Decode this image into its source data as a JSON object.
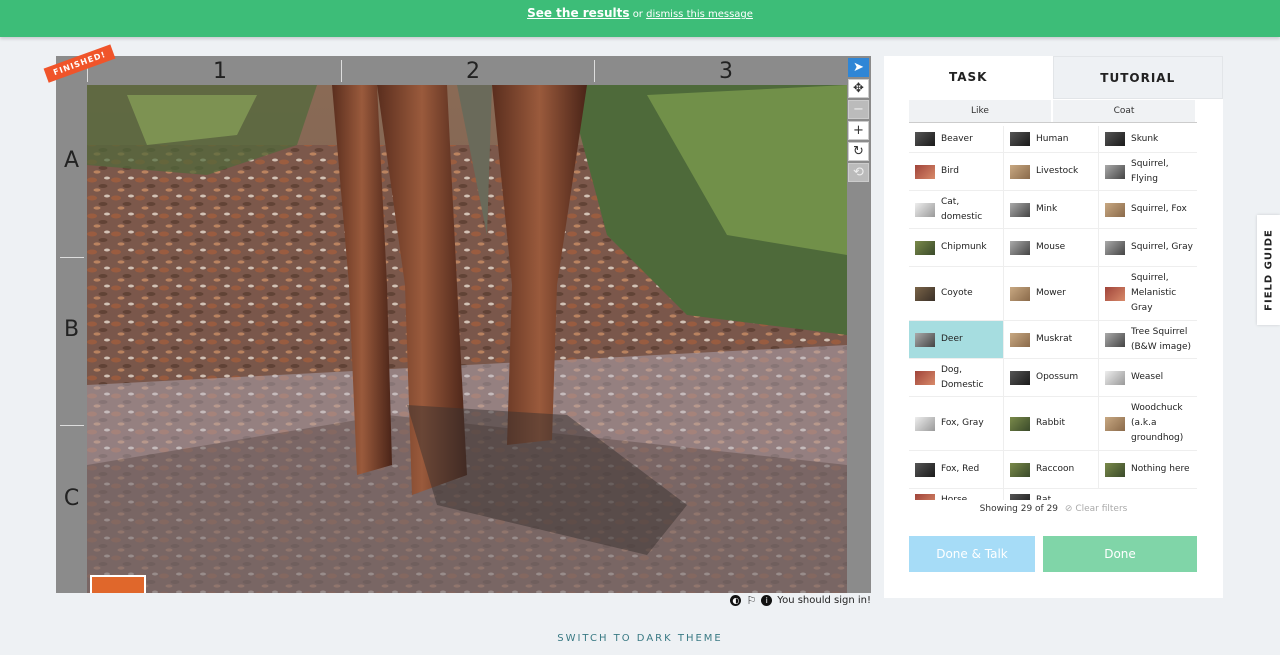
{
  "banner": {
    "see_results": "See the results",
    "or": "or",
    "dismiss": "dismiss this message"
  },
  "viewer": {
    "finished": "FINISHED!",
    "columns": [
      "1",
      "2",
      "3"
    ],
    "rows": [
      "A",
      "B",
      "C"
    ],
    "tools": [
      "pointer-icon",
      "move-icon",
      "zoom-out-icon",
      "zoom-in-icon",
      "rotate-icon",
      "reset-icon"
    ],
    "sign_in": "You should sign in!"
  },
  "task": {
    "tab_task": "TASK",
    "tab_tutorial": "TUTORIAL",
    "filter_like": "Like",
    "filter_coat": "Coat",
    "choices": [
      [
        {
          "label": "Beaver",
          "t": "dark"
        },
        {
          "label": "Human",
          "t": "dark"
        },
        {
          "label": "Skunk",
          "t": "dark"
        }
      ],
      [
        {
          "label": "Bird",
          "t": "red"
        },
        {
          "label": "Livestock",
          "t": "tan"
        },
        {
          "label": "Squirrel, Flying",
          "t": "grey"
        }
      ],
      [
        {
          "label": "Cat, domestic",
          "t": "light"
        },
        {
          "label": "Mink",
          "t": "grey"
        },
        {
          "label": "Squirrel, Fox",
          "t": "tan"
        }
      ],
      [
        {
          "label": "Chipmunk",
          "t": "green"
        },
        {
          "label": "Mouse",
          "t": "grey"
        },
        {
          "label": "Squirrel, Gray",
          "t": "grey"
        }
      ],
      [
        {
          "label": "Coyote",
          "t": "brown"
        },
        {
          "label": "Mower",
          "t": "tan"
        },
        {
          "label": "Squirrel, Melanistic Gray",
          "t": "red"
        }
      ],
      [
        {
          "label": "Deer",
          "t": "grey",
          "sel": true
        },
        {
          "label": "Muskrat",
          "t": "tan"
        },
        {
          "label": "Tree Squirrel (B&W image)",
          "t": "grey"
        }
      ],
      [
        {
          "label": "Dog, Domestic",
          "t": "red"
        },
        {
          "label": "Opossum",
          "t": "dark"
        },
        {
          "label": "Weasel",
          "t": "light"
        }
      ],
      [
        {
          "label": "Fox, Gray",
          "t": "light"
        },
        {
          "label": "Rabbit",
          "t": "green"
        },
        {
          "label": "Woodchuck (a.k.a groundhog)",
          "t": "tan"
        }
      ],
      [
        {
          "label": "Fox, Red",
          "t": "dark"
        },
        {
          "label": "Raccoon",
          "t": "green"
        },
        {
          "label": "Nothing here",
          "t": "green"
        }
      ],
      [
        {
          "label": "Horse",
          "t": "red"
        },
        {
          "label": "Rat",
          "t": "dark"
        }
      ]
    ],
    "showing": "Showing 29 of 29",
    "clear_filters": "Clear filters",
    "done_talk": "Done & Talk",
    "done": "Done"
  },
  "field_guide": "FIELD GUIDE",
  "switch_theme": "SWITCH TO DARK THEME"
}
